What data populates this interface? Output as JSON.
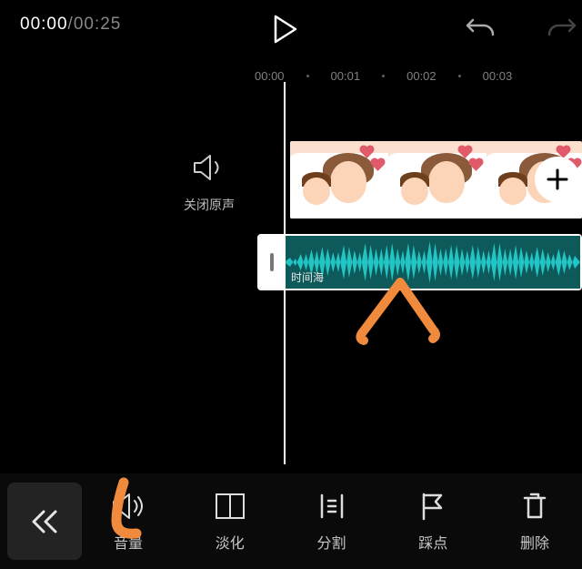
{
  "transport": {
    "current_time": "00:00",
    "duration": "00:25",
    "separator": "/"
  },
  "ruler": {
    "ticks": [
      "00:00",
      "00:01",
      "00:02",
      "00:03"
    ]
  },
  "mute": {
    "label": "关闭原声",
    "icon": "speaker-icon"
  },
  "video_track": {
    "clip_count": 3,
    "add_label": "+"
  },
  "audio_track": {
    "title": "时间海"
  },
  "toolbar": {
    "back_icon": "chevrons-left-icon",
    "tools": [
      {
        "id": "volume",
        "label": "音量",
        "icon": "speaker-icon"
      },
      {
        "id": "fade",
        "label": "淡化",
        "icon": "fade-icon"
      },
      {
        "id": "split",
        "label": "分割",
        "icon": "split-icon"
      },
      {
        "id": "beat",
        "label": "踩点",
        "icon": "flag-icon"
      },
      {
        "id": "delete",
        "label": "删除",
        "icon": "delete-icon"
      }
    ]
  },
  "annotations": {
    "arrow_on_audio": true,
    "circle_on_volume": true,
    "color": "#f08a3c"
  }
}
